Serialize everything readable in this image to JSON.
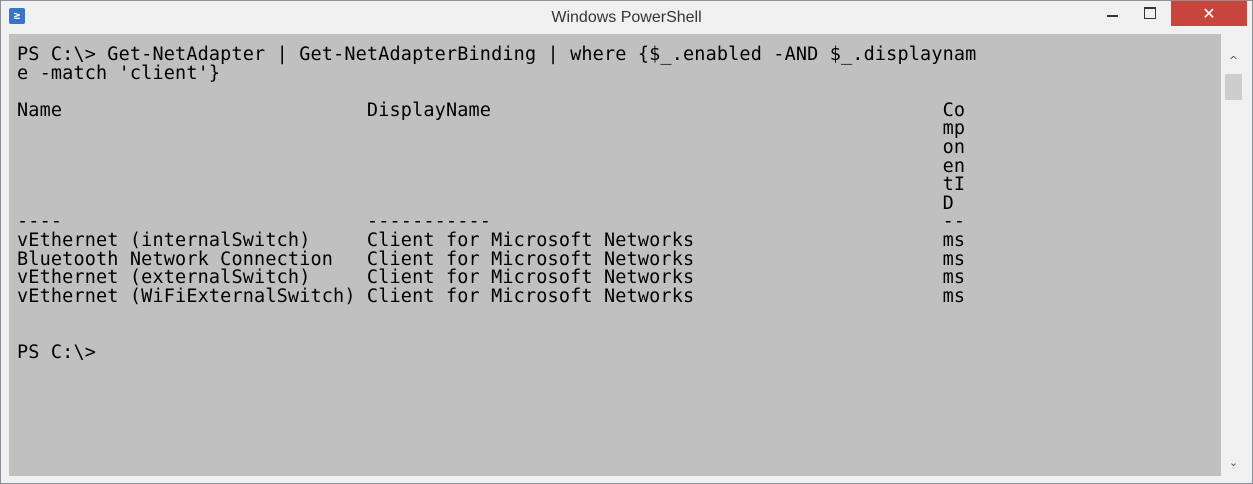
{
  "window": {
    "title": "Windows PowerShell",
    "controls": {
      "minimize_icon": "minimize-icon",
      "maximize_icon": "maximize-icon",
      "close_label": "✕"
    }
  },
  "console": {
    "text": "PS C:\\> Get-NetAdapter | Get-NetAdapterBinding | where {$_.enabled -AND $_.displaynam\ne -match 'client'}\n\nName                           DisplayName                                        Co\n                                                                                  mp\n                                                                                  on\n                                                                                  en\n                                                                                  tI\n                                                                                  D\n----                           -----------                                        --\nvEthernet (internalSwitch)     Client for Microsoft Networks                      ms\nBluetooth Network Connection   Client for Microsoft Networks                      ms\nvEthernet (externalSwitch)     Client for Microsoft Networks                      ms\nvEthernet (WiFiExternalSwitch) Client for Microsoft Networks                      ms\n\n\nPS C:\\>"
  },
  "scrollbar": {
    "up_glyph": "^",
    "down_glyph": "⌄"
  },
  "colors": {
    "console_bg": "#c0c0c0",
    "close_button": "#c7453d",
    "frame": "#f0f0f0"
  }
}
